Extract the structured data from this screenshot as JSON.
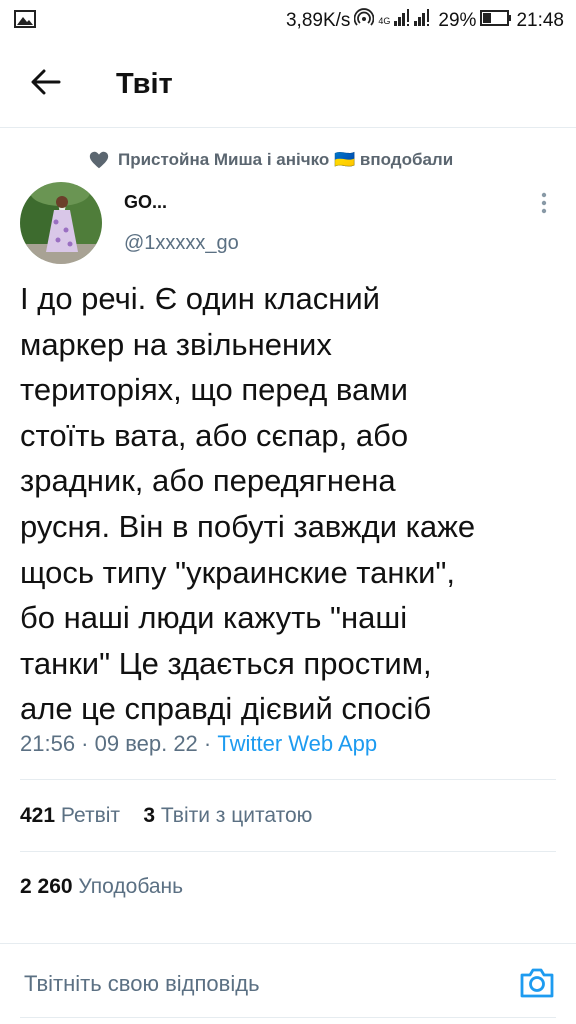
{
  "status_bar": {
    "network_speed": "3,89K/s",
    "network_type": "4G",
    "battery": "29%",
    "time": "21:48"
  },
  "header": {
    "title": "Твіт"
  },
  "social_context": {
    "text": "Пристойна Миша і анічко 🇺🇦 вподобали"
  },
  "tweet": {
    "author_name": "GO...",
    "author_handle": "@1xxxxx_go",
    "text": "І до речі. Є один класний\nмаркер на звільнених\nтериторіях, що перед вами\nстоїть вата, або сєпар, або\nзрадник, або передягнена\nрусня. Він в побуті завжди каже\nщось типу \"украинские танки\",\nбо наші люди кажуть \"наші\nтанки\" Це здається простим,\nале це справді дієвий спосіб",
    "time": "21:56 · 09 вер. 22 · ",
    "source": "Twitter Web App"
  },
  "stats": {
    "retweets_count": "421",
    "retweets_label": "Ретвіт",
    "quotes_count": "3",
    "quotes_label": "Твіти з цитатою",
    "likes_count": "2 260",
    "likes_label": "Уподобань"
  },
  "reply": {
    "placeholder": "Твітніть свою відповідь"
  },
  "icons": {
    "back": "arrow-left-icon",
    "more": "more-vertical-icon",
    "heart": "heart-icon",
    "camera": "camera-icon",
    "gallery": "gallery-icon"
  },
  "colors": {
    "accent": "#1d9bf0",
    "muted": "#5b7083",
    "divider": "#e6ecf0"
  }
}
